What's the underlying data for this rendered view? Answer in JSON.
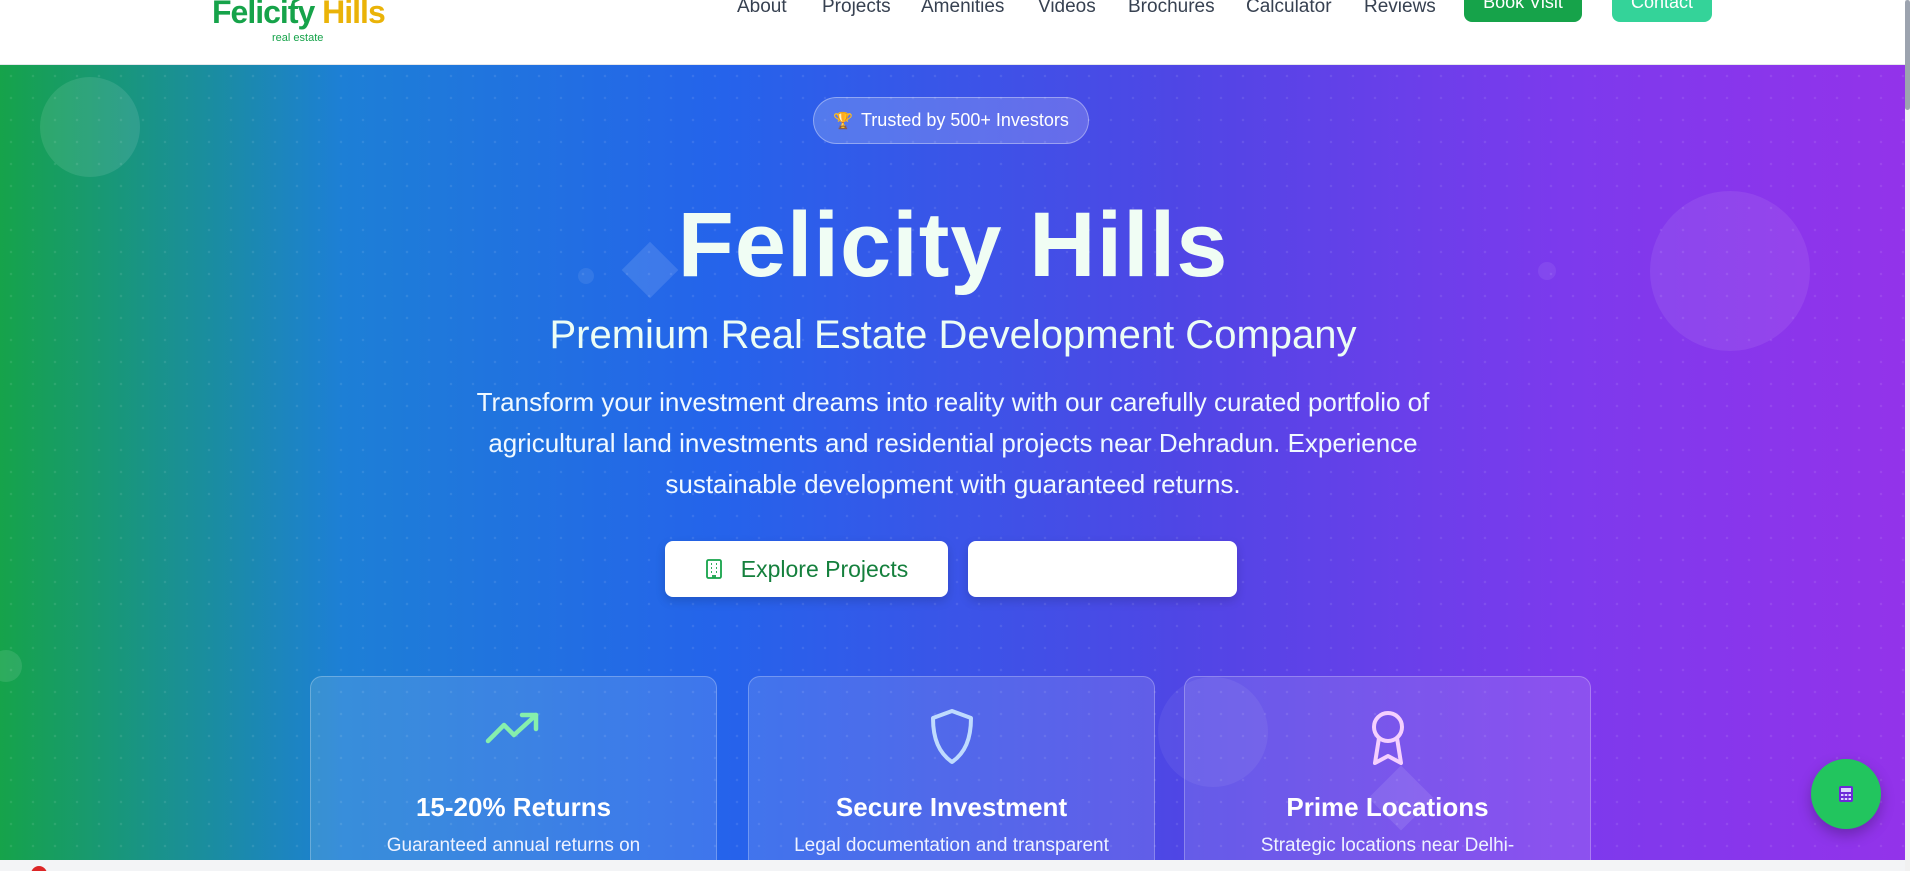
{
  "brand": {
    "name_part1": "Felicity",
    "name_part2": "Hills",
    "tagline": "real estate"
  },
  "nav": {
    "items": [
      "About",
      "Projects",
      "Amenities",
      "Videos",
      "Brochures",
      "Calculator",
      "Reviews"
    ],
    "book_label": "Book Visit",
    "contact_label": "Contact"
  },
  "hero": {
    "badge_icon": "trophy-icon",
    "badge_text": "Trusted by 500+ Investors",
    "title": "Felicity Hills",
    "subtitle": "Premium Real Estate Development Company",
    "description": "Transform your investment dreams into reality with our carefully curated portfolio of agricultural land investments and residential projects near Dehradun. Experience sustainable development with guaranteed returns.",
    "primary_button": "Explore Projects",
    "primary_button_icon": "building-icon",
    "secondary_button": ""
  },
  "features": [
    {
      "icon": "trending-up-icon",
      "title": "15-20% Returns",
      "text": "Guaranteed annual returns on"
    },
    {
      "icon": "shield-icon",
      "title": "Secure Investment",
      "text": "Legal documentation and transparent"
    },
    {
      "icon": "award-icon",
      "title": "Prime Locations",
      "text": "Strategic locations near Delhi-"
    }
  ],
  "floating_button_icon": "calculator-icon",
  "colors": {
    "brand_green": "#16a34a",
    "brand_yellow": "#eab308",
    "contact_mint": "#34d399",
    "gradient_start": "#16a34a",
    "gradient_mid": "#2563eb",
    "gradient_end": "#9333ea"
  }
}
